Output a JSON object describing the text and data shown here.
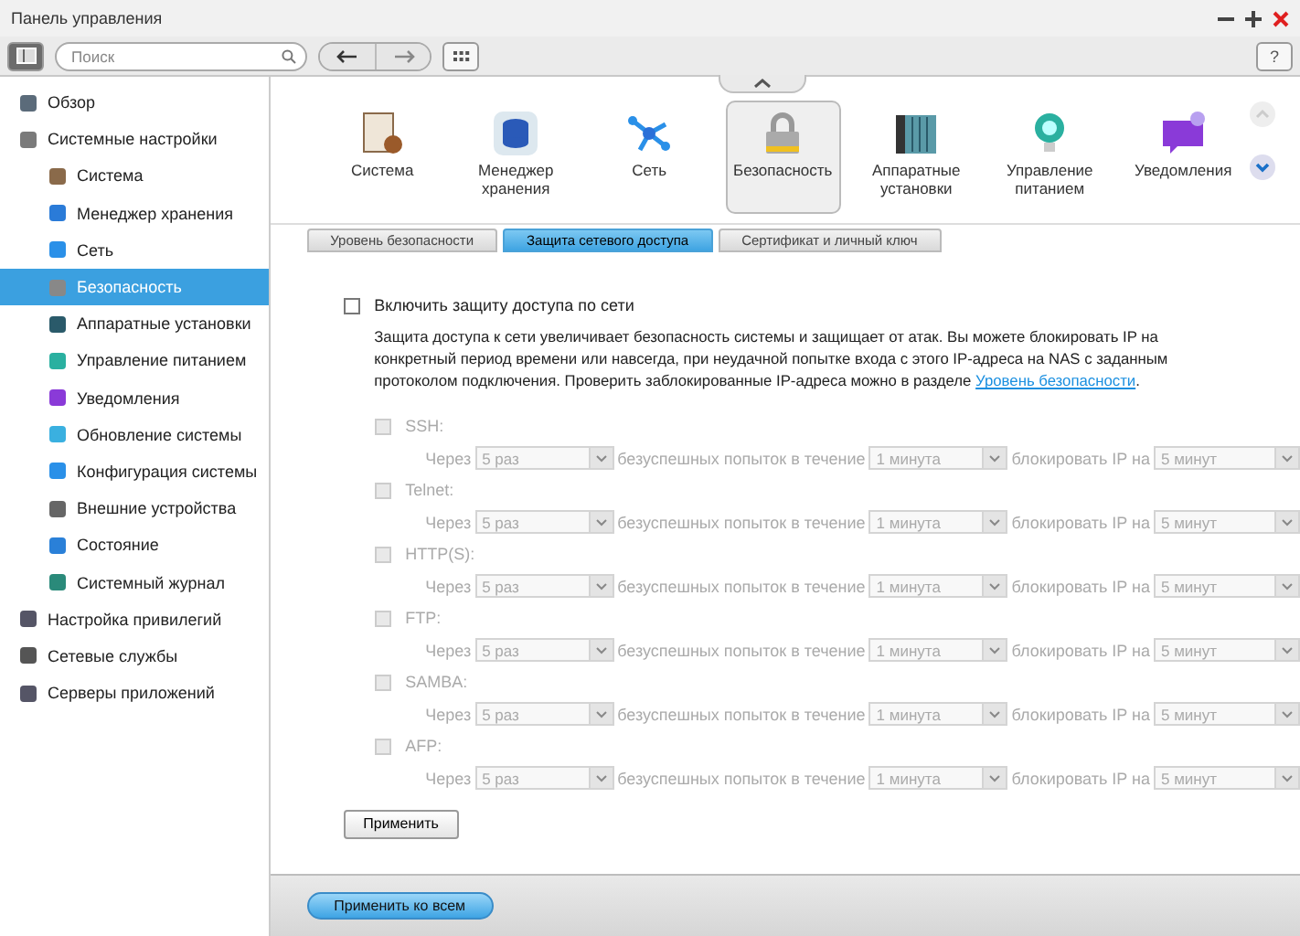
{
  "window": {
    "title": "Панель управления"
  },
  "toolbar": {
    "search": {
      "placeholder": "Поиск"
    },
    "help": "?"
  },
  "sidebar": {
    "items": [
      {
        "label": "Обзор",
        "selected": false
      },
      {
        "label": "Системные настройки",
        "selected": false,
        "children": [
          {
            "label": "Система",
            "selected": false
          },
          {
            "label": "Менеджер хранения",
            "selected": false
          },
          {
            "label": "Сеть",
            "selected": false
          },
          {
            "label": "Безопасность",
            "selected": true
          },
          {
            "label": "Аппаратные установки",
            "selected": false
          },
          {
            "label": "Управление питанием",
            "selected": false
          },
          {
            "label": "Уведомления",
            "selected": false
          },
          {
            "label": "Обновление системы",
            "selected": false
          },
          {
            "label": "Конфигурация системы",
            "selected": false
          },
          {
            "label": "Внешние устройства",
            "selected": false
          },
          {
            "label": "Состояние",
            "selected": false
          },
          {
            "label": "Системный журнал",
            "selected": false
          }
        ]
      },
      {
        "label": "Настройка привилегий",
        "selected": false
      },
      {
        "label": "Сетевые службы",
        "selected": false
      },
      {
        "label": "Серверы приложений",
        "selected": false
      }
    ]
  },
  "app_strip": [
    {
      "label": "Система",
      "selected": false
    },
    {
      "label": "Менеджер хранения",
      "selected": false
    },
    {
      "label": "Сеть",
      "selected": false
    },
    {
      "label": "Безопасность",
      "selected": true
    },
    {
      "label": "Аппаратные установки",
      "selected": false
    },
    {
      "label": "Управление питанием",
      "selected": false
    },
    {
      "label": "Уведомления",
      "selected": false
    }
  ],
  "tabs": [
    {
      "label": "Уровень безопасности",
      "selected": false
    },
    {
      "label": "Защита сетевого доступа",
      "selected": true
    },
    {
      "label": "Сертификат и личный ключ",
      "selected": false
    }
  ],
  "enable": {
    "label": "Включить защиту доступа по сети",
    "checked": false
  },
  "description": {
    "text": "Защита доступа к сети увеличивает безопасность системы и защищает от атак. Вы можете блокировать IP на конкретный период времени или навсегда, при неудачной попытке входа с этого IP-адреса на NAS с заданным протоколом подключения. Проверить заблокированные IP-адреса можно в разделе ",
    "link": "Уровень безопасности",
    "end": "."
  },
  "protocols": [
    {
      "label": "SSH:",
      "checked": false,
      "disabled": true,
      "prefix": "Через",
      "attempts": "5 раз",
      "middle": "безуспешных попыток в течение",
      "period": "1 минута",
      "block_label": "блокировать IP на",
      "duration": "5 минут"
    },
    {
      "label": "Telnet:",
      "checked": false,
      "disabled": true,
      "prefix": "Через",
      "attempts": "5 раз",
      "middle": "безуспешных попыток в течение",
      "period": "1 минута",
      "block_label": "блокировать IP на",
      "duration": "5 минут"
    },
    {
      "label": "HTTP(S):",
      "checked": false,
      "disabled": true,
      "prefix": "Через",
      "attempts": "5 раз",
      "middle": "безуспешных попыток в течение",
      "period": "1 минута",
      "block_label": "блокировать IP на",
      "duration": "5 минут"
    },
    {
      "label": "FTP:",
      "checked": false,
      "disabled": true,
      "prefix": "Через",
      "attempts": "5 раз",
      "middle": "безуспешных попыток в течение",
      "period": "1 минута",
      "block_label": "блокировать IP на",
      "duration": "5 минут"
    },
    {
      "label": "SAMBA:",
      "checked": false,
      "disabled": true,
      "prefix": "Через",
      "attempts": "5 раз",
      "middle": "безуспешных попыток в течение",
      "period": "1 минута",
      "block_label": "блокировать IP на",
      "duration": "5 минут"
    },
    {
      "label": "AFP:",
      "checked": false,
      "disabled": true,
      "prefix": "Через",
      "attempts": "5 раз",
      "middle": "безуспешных попыток в течение",
      "period": "1 минута",
      "block_label": "блокировать IP на",
      "duration": "5 минут"
    }
  ],
  "apply_button": "Применить",
  "footer": {
    "apply_all_button": "Применить ко всем"
  }
}
